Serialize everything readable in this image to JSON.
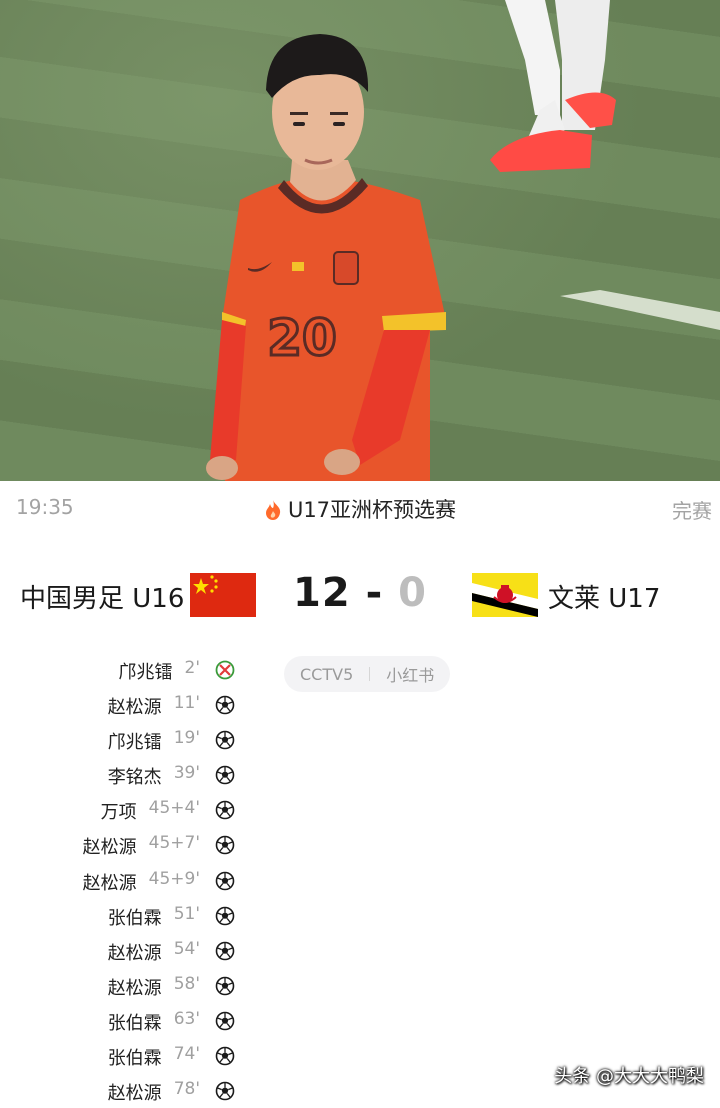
{
  "header": {
    "time": "19:35",
    "league": "U17亚洲杯预选赛",
    "status": "完赛"
  },
  "match": {
    "home": {
      "name": "中国男足 U16",
      "flag": "china-flag-icon",
      "score": "12"
    },
    "away": {
      "name": "文莱 U17",
      "flag": "brunei-flag-icon",
      "score": "0"
    },
    "separator": "-"
  },
  "broadcast": [
    "CCTV5",
    "小红书"
  ],
  "goals": [
    {
      "player": "邝兆镭",
      "minute": "2'",
      "type": "penalty"
    },
    {
      "player": "赵松源",
      "minute": "11'",
      "type": "goal"
    },
    {
      "player": "邝兆镭",
      "minute": "19'",
      "type": "goal"
    },
    {
      "player": "李铭杰",
      "minute": "39'",
      "type": "goal"
    },
    {
      "player": "万项",
      "minute": "45+4'",
      "type": "goal"
    },
    {
      "player": "赵松源",
      "minute": "45+7'",
      "type": "goal"
    },
    {
      "player": "赵松源",
      "minute": "45+9'",
      "type": "goal"
    },
    {
      "player": "张伯霖",
      "minute": "51'",
      "type": "goal"
    },
    {
      "player": "赵松源",
      "minute": "54'",
      "type": "goal"
    },
    {
      "player": "赵松源",
      "minute": "58'",
      "type": "goal"
    },
    {
      "player": "张伯霖",
      "minute": "63'",
      "type": "goal"
    },
    {
      "player": "张伯霖",
      "minute": "74'",
      "type": "goal"
    },
    {
      "player": "赵松源",
      "minute": "78'",
      "type": "goal"
    }
  ],
  "photo": {
    "jersey_number": "20"
  },
  "watermark": "头条 @大大大鸭梨",
  "colors": {
    "accent": "#ff6a2b",
    "jersey": "#e8552b",
    "pitch": "#6f8a5e"
  }
}
